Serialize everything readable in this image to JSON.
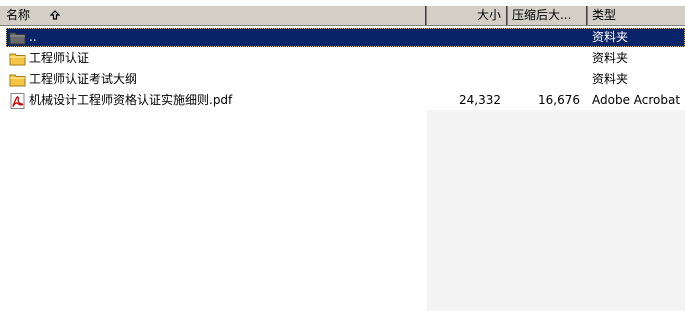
{
  "columns": {
    "name": "名称",
    "size": "大小",
    "packed": "压缩后大...",
    "type": "类型"
  },
  "rows": [
    {
      "name": "..",
      "size": "",
      "packed": "",
      "type": "资料夹",
      "icon": "folder-up-icon",
      "selected": true
    },
    {
      "name": "工程师认证",
      "size": "",
      "packed": "",
      "type": "资料夹",
      "icon": "folder-icon",
      "selected": false
    },
    {
      "name": "工程师认证考试大纲",
      "size": "",
      "packed": "",
      "type": "资料夹",
      "icon": "folder-icon",
      "selected": false
    },
    {
      "name": "机械设计工程师资格认证实施细则.pdf",
      "size": "24,332",
      "packed": "16,676",
      "type": "Adobe Acrobat",
      "icon": "pdf-icon",
      "selected": false
    }
  ],
  "colors": {
    "selection": "#0a246a",
    "folder": "#f4c542",
    "header": "#d4d0c8"
  }
}
